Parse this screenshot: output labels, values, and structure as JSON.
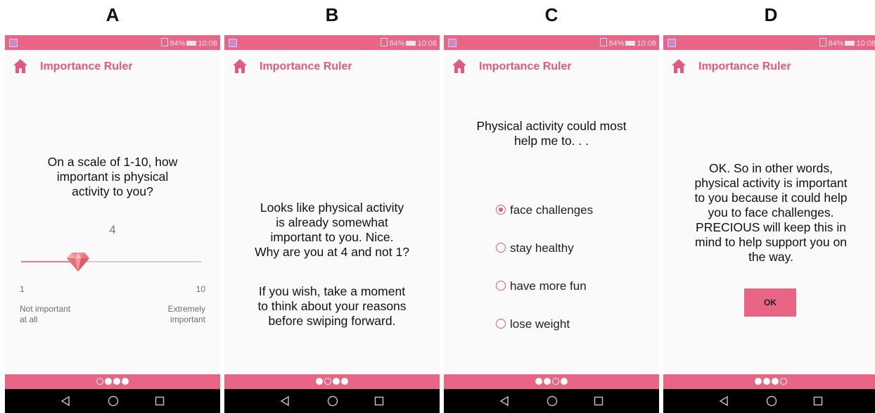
{
  "panel_letters": [
    "A",
    "B",
    "C",
    "D"
  ],
  "status_bar": {
    "battery": "84%",
    "time": "10:08"
  },
  "app_title": "Importance Ruler",
  "colors": {
    "accent": "#e96585",
    "title": "#e25a7d",
    "nav": "#000000"
  },
  "icons": {
    "home": "home-icon",
    "back": "back-triangle-icon",
    "home_nav": "home-circle-icon",
    "recents": "recents-square-icon",
    "gem": "diamond-gem-icon"
  },
  "panel_a": {
    "question": [
      "On a scale of 1-10, how",
      "important is physical",
      "activity to you?"
    ],
    "value": "4",
    "slider": {
      "min": "1",
      "max": "10",
      "value_fraction": 0.33
    },
    "min_label": [
      "Not important",
      "at all"
    ],
    "max_label": [
      "Extremely",
      "important"
    ],
    "page_indicator": {
      "current": 1,
      "total": 4
    }
  },
  "panel_b": {
    "message": [
      "Looks like physical activity",
      "is already somewhat",
      "important to you. Nice.",
      "Why are you at 4 and not 1?"
    ],
    "hint": [
      "If you wish, take a moment",
      "to think about your reasons",
      "before swiping forward."
    ],
    "page_indicator": {
      "current": 2,
      "total": 4
    }
  },
  "panel_c": {
    "question": [
      "Physical activity could most",
      "help me to. . ."
    ],
    "options": [
      "face challenges",
      "stay healthy",
      "have more fun",
      "lose weight"
    ],
    "selected_index": 0,
    "page_indicator": {
      "current": 3,
      "total": 4
    }
  },
  "panel_d": {
    "message": [
      "OK. So in other words,",
      "physical activity is important",
      "to you because it could help",
      "you to face challenges.",
      "PRECIOUS will keep this in",
      "mind to help support you on",
      "the way."
    ],
    "ok_label": "OK",
    "page_indicator": {
      "current": 4,
      "total": 4
    }
  }
}
